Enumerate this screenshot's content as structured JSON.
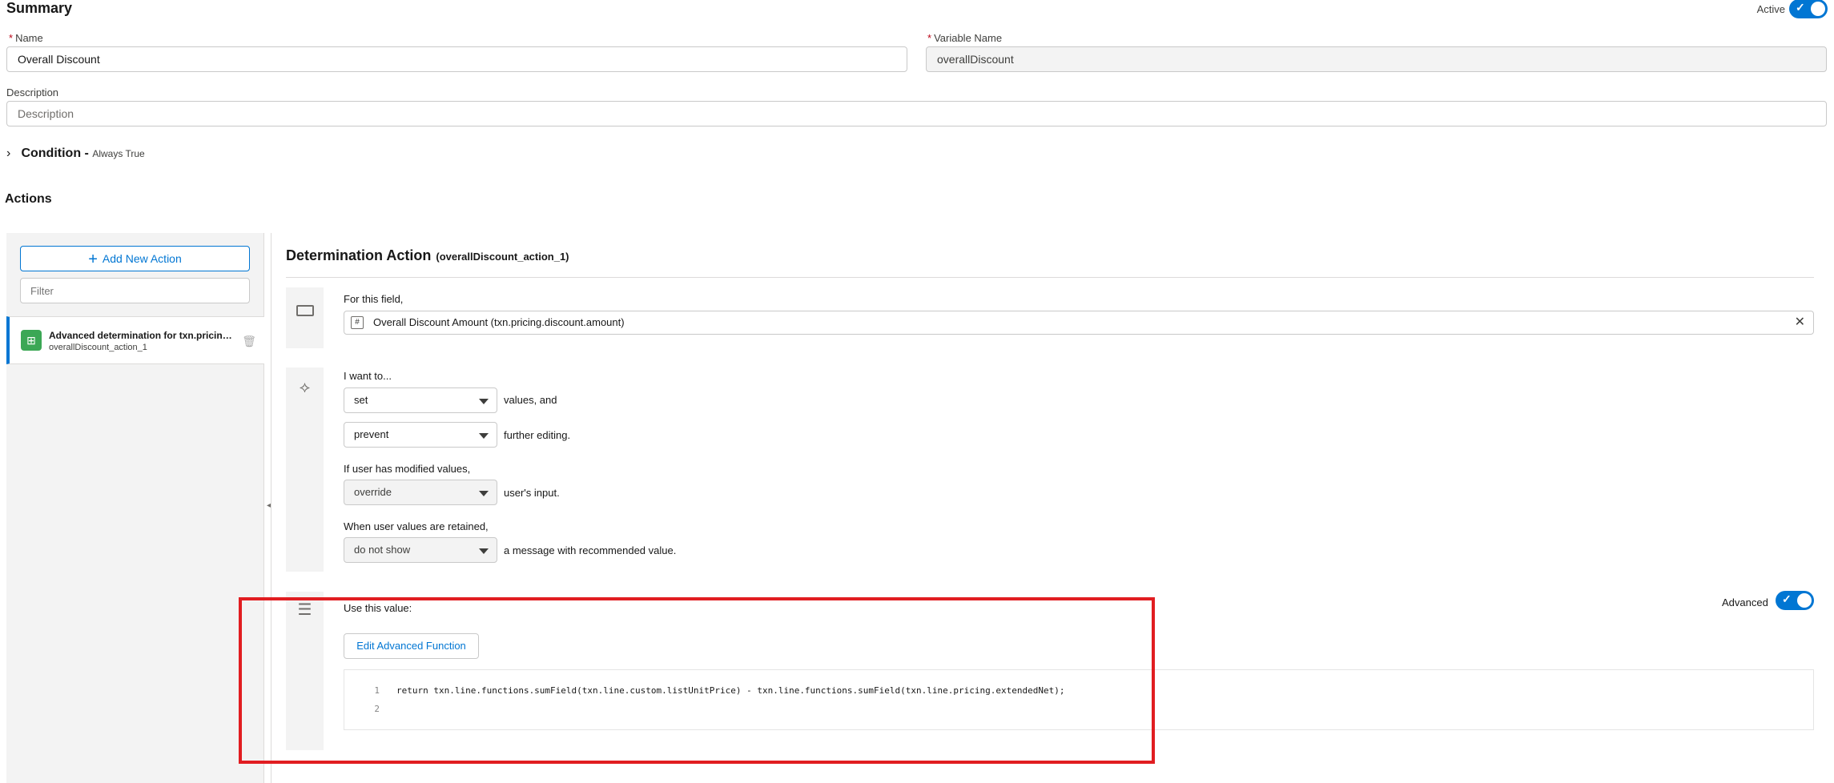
{
  "summary": {
    "title": "Summary",
    "active_label": "Active",
    "active_on": true,
    "name_label": "Name",
    "name_value": "Overall Discount",
    "variable_label": "Variable Name",
    "variable_value": "overallDiscount",
    "description_label": "Description",
    "description_placeholder": "Description",
    "required_mark": "*"
  },
  "condition": {
    "title": "Condition -",
    "subtitle": "Always True"
  },
  "actions": {
    "title": "Actions",
    "add_button": "Add New Action",
    "filter_placeholder": "Filter",
    "items": [
      {
        "title": "Advanced determination for txn.pricing.discount.amount",
        "subtitle": "overallDiscount_action_1"
      }
    ]
  },
  "determination": {
    "title": "Determination Action",
    "subtitle": "(overallDiscount_action_1)",
    "field_intro": "For this field,",
    "field_value": "Overall Discount Amount (txn.pricing.discount.amount)",
    "want_label": "I want to...",
    "set_value": "set",
    "set_after": "values, and",
    "prevent_value": "prevent",
    "prevent_after": "further editing.",
    "modified_label": "If user has modified values,",
    "override_value": "override",
    "override_after": "user's input.",
    "retained_label": "When user values are retained,",
    "show_value": "do not show",
    "show_after": "a message with recommended value.",
    "use_value_label": "Use this value:",
    "advanced_label": "Advanced",
    "advanced_on": true,
    "edit_button": "Edit Advanced Function",
    "code_lines": [
      {
        "num": "1",
        "text": "return txn.line.functions.sumField(txn.line.custom.listUnitPrice) - txn.line.functions.sumField(txn.line.pricing.extendedNet);"
      },
      {
        "num": "2",
        "text": ""
      }
    ]
  },
  "colors": {
    "accent": "#0176d3",
    "highlight_box": "#e11d21",
    "action_icon": "#3ba755"
  }
}
